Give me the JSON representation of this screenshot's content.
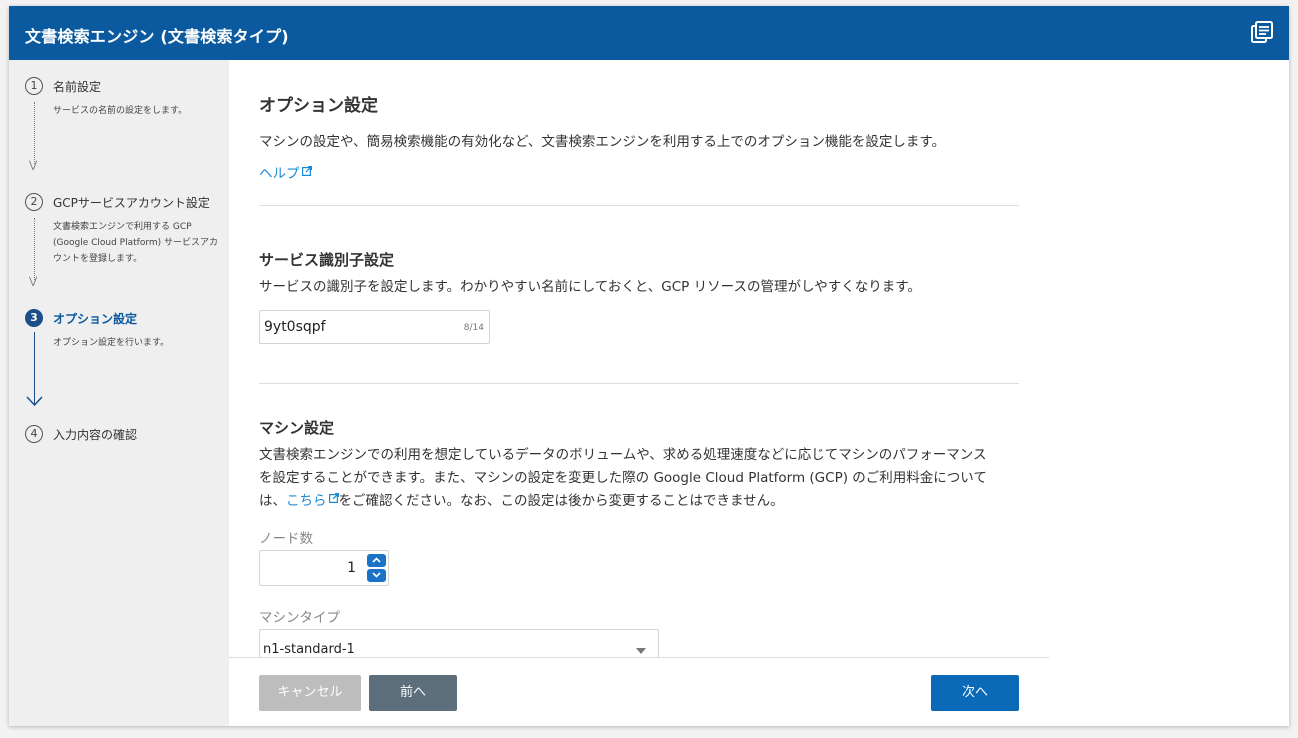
{
  "header": {
    "title": "文書検索エンジン (文書検索タイプ)",
    "docs_icon": "documentation-icon"
  },
  "sidebar": {
    "steps": [
      {
        "number": "1",
        "label": "名前設定",
        "description": "サービスの名前の設定をします。"
      },
      {
        "number": "2",
        "label": "GCPサービスアカウント設定",
        "description": "文書検索エンジンで利用する GCP (Google Cloud Platform) サービスアカウントを登録します。"
      },
      {
        "number": "3",
        "label": "オプション設定",
        "description": "オプション設定を行います。"
      },
      {
        "number": "4",
        "label": "入力内容の確認",
        "description": ""
      }
    ]
  },
  "main": {
    "title": "オプション設定",
    "intro": "マシンの設定や、簡易検索機能の有効化など、文書検索エンジンを利用する上でのオプション機能を設定します。",
    "help_link": "ヘルプ",
    "service_id": {
      "heading": "サービス識別子設定",
      "description": "サービスの識別子を設定します。わかりやすい名前にしておくと、GCP リソースの管理がしやすくなります。",
      "value": "9yt0sqpf",
      "counter": "8/14"
    },
    "machine": {
      "heading": "マシン設定",
      "desc_line1": "文書検索エンジンでの利用を想定しているデータのボリュームや、求める処理速度などに応じてマシンのパフォーマンス",
      "desc_line2": "を設定することができます。また、マシンの設定を変更した際の Google Cloud Platform (GCP) のご利用料金について",
      "desc_line3_prefix": "は、",
      "desc_link": "こちら",
      "desc_line3_suffix": "をご確認ください。なお、この設定は後から変更することはできません。",
      "node_count_label": "ノード数",
      "node_count_value": "1",
      "machine_type_label": "マシンタイプ",
      "machine_type_value": "n1-standard-1"
    }
  },
  "footer": {
    "cancel_label": "キャンセル",
    "prev_label": "前へ",
    "next_label": "次へ"
  },
  "colors": {
    "header_bg": "#0b5aa0",
    "link": "#1a8ad4",
    "primary_button": "#0b6ab8",
    "secondary_button": "#5d6f7b",
    "disabled_button": "#bdbdbd"
  }
}
